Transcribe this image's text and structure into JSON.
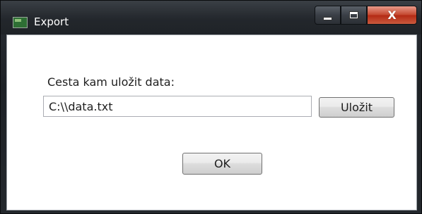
{
  "window": {
    "title": "Export"
  },
  "titlebar": {
    "app_icon": "app-icon",
    "minimize_icon": "minimize-icon",
    "maximize_icon": "maximize-icon",
    "close_label": "X"
  },
  "form": {
    "path_label": "Cesta kam uložit data:",
    "path_value": "C:\\\\data.txt",
    "save_button": "Uložit",
    "ok_button": "OK"
  }
}
